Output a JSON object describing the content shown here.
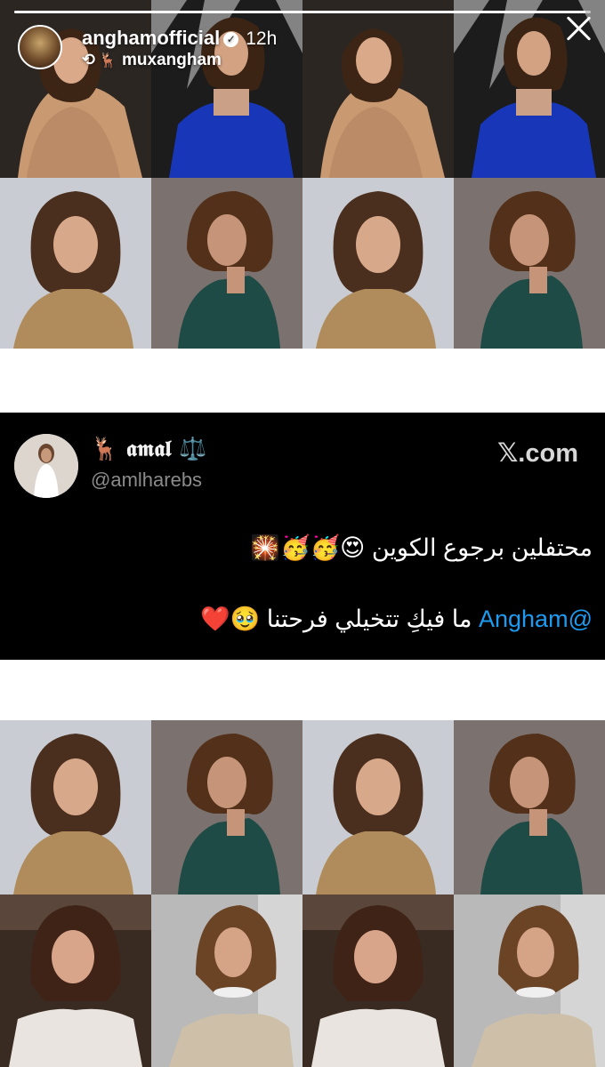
{
  "story": {
    "username": "anghamofficial",
    "verified_icon": "verified-badge-icon",
    "time": "12h",
    "reposted_from": "muxangham",
    "progress": 0.99
  },
  "tweet": {
    "display_name": "🦌 𝖆𝖒𝖆𝖑 ⚖️",
    "handle": "@amlharebs",
    "source": "𝕏.com",
    "line1": "محتفلين برجوع الكوين 😍🥳🥳🎇",
    "line2_mention": "@Angham",
    "line2_rest": " ما فيكِ تتخيلي فرحتنا 🥹❤️"
  },
  "colors": {
    "mention": "#1d9bf0",
    "tweet_bg": "#000000",
    "handle": "#8b8b8b"
  }
}
